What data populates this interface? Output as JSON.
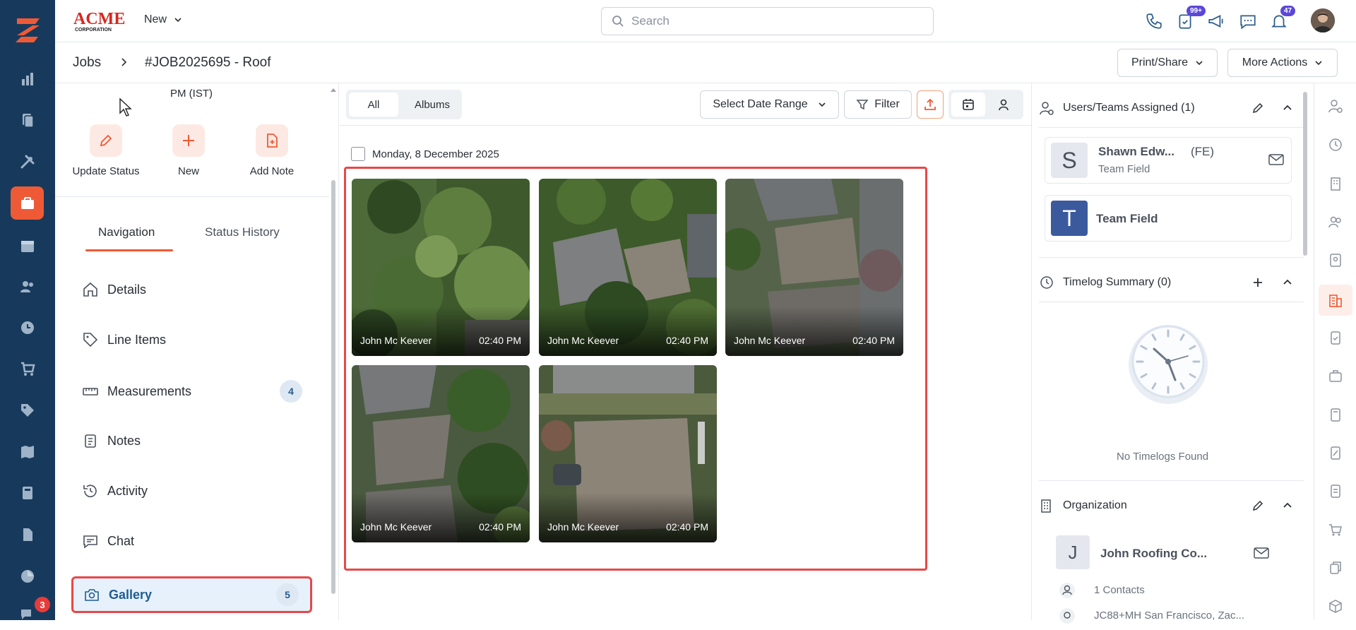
{
  "app": {
    "logo": "ACME CORPORATION",
    "new_menu": "New",
    "search_placeholder": "Search",
    "task_badge": "99+",
    "notif_badge": "47",
    "rail_badge": "3"
  },
  "breadcrumb": {
    "jobs": "Jobs",
    "title": "#JOB2025695 - Roof"
  },
  "header_actions": {
    "print_share": "Print/Share",
    "more_actions": "More Actions"
  },
  "left": {
    "pm_text": "PM (IST)",
    "quick_actions": [
      {
        "label": "Update Status",
        "icon": "pencil-icon"
      },
      {
        "label": "New",
        "icon": "plus-icon"
      },
      {
        "label": "Add Note",
        "icon": "add-note-icon"
      }
    ],
    "tabs": [
      {
        "label": "Navigation",
        "active": true
      },
      {
        "label": "Status History",
        "active": false
      }
    ],
    "nav": [
      {
        "label": "Details",
        "icon": "home-icon"
      },
      {
        "label": "Line Items",
        "icon": "tag-icon"
      },
      {
        "label": "Measurements",
        "icon": "ruler-icon",
        "count": "4"
      },
      {
        "label": "Notes",
        "icon": "clipboard-icon"
      },
      {
        "label": "Activity",
        "icon": "history-icon"
      },
      {
        "label": "Chat",
        "icon": "chat-icon"
      },
      {
        "label": "Gallery",
        "icon": "camera-icon",
        "count": "5",
        "selected": true
      }
    ]
  },
  "gallery": {
    "seg_all": "All",
    "seg_albums": "Albums",
    "date_range": "Select Date Range",
    "filter": "Filter",
    "date_header": "Monday, 8 December 2025",
    "photos": [
      {
        "author": "John Mc Keever",
        "time": "02:40 PM"
      },
      {
        "author": "John Mc Keever",
        "time": "02:40 PM"
      },
      {
        "author": "John Mc Keever",
        "time": "02:40 PM"
      },
      {
        "author": "John Mc Keever",
        "time": "02:40 PM"
      },
      {
        "author": "John Mc Keever",
        "time": "02:40 PM"
      }
    ]
  },
  "right": {
    "users_title": "Users/Teams Assigned (1)",
    "user_initial": "S",
    "user_name": "Shawn Edw...",
    "user_role": "(FE)",
    "user_team": "Team Field",
    "team_initial": "T",
    "team_name": "Team Field",
    "timelog_title": "Timelog Summary (0)",
    "timelog_empty": "No Timelogs Found",
    "org_title": "Organization",
    "org_initial": "J",
    "org_name": "John Roofing Co...",
    "contacts": "1 Contacts",
    "address": "JC88+MH San Francisco, Zac..."
  },
  "colors": {
    "rail": "#173a5c",
    "accent": "#ef5a36",
    "selection_border": "#e84848",
    "badge_purple": "#5b47d8"
  }
}
